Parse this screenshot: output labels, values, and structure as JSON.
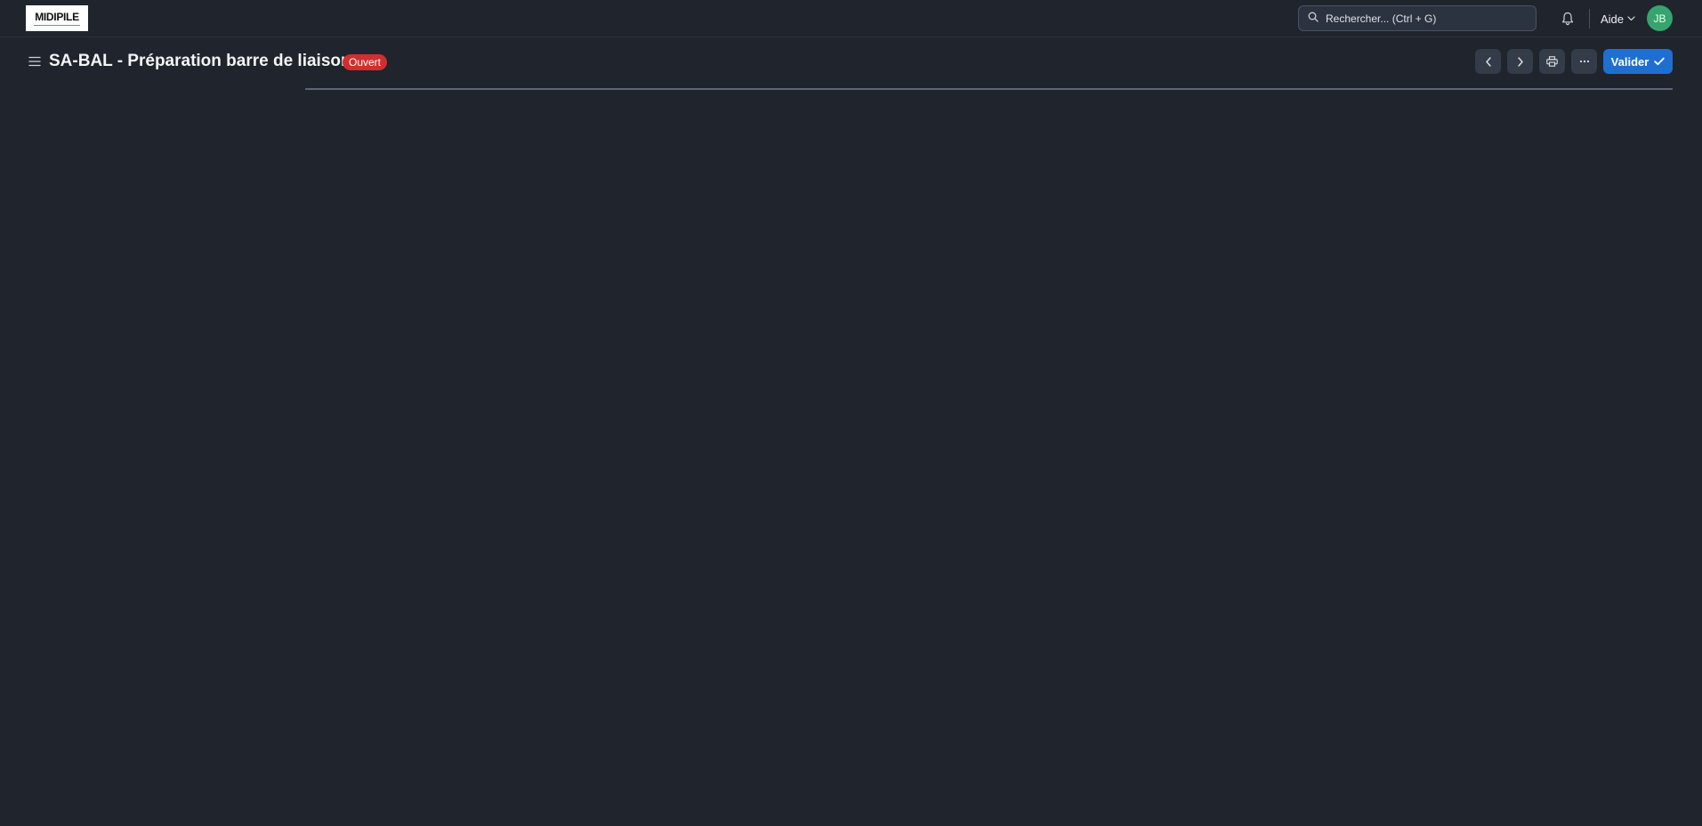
{
  "navbar": {
    "logo_text": "MIDIPILE",
    "search_placeholder": "Rechercher... (Ctrl + G)",
    "help_label": "Aide",
    "avatar_initials": "JB",
    "avatar_color": "#36a46e"
  },
  "page": {
    "title": "SA-BAL - Préparation barre de liaison",
    "status_badge": "Ouvert",
    "status_color": "#d12f2f",
    "actions": {
      "prev_icon": "chevron-left-icon",
      "next_icon": "chevron-right-icon",
      "print_icon": "printer-icon",
      "more_icon": "ellipsis-icon",
      "submit_label": "Valider",
      "submit_icon": "check-icon",
      "submit_color": "#1f6fd1"
    }
  }
}
